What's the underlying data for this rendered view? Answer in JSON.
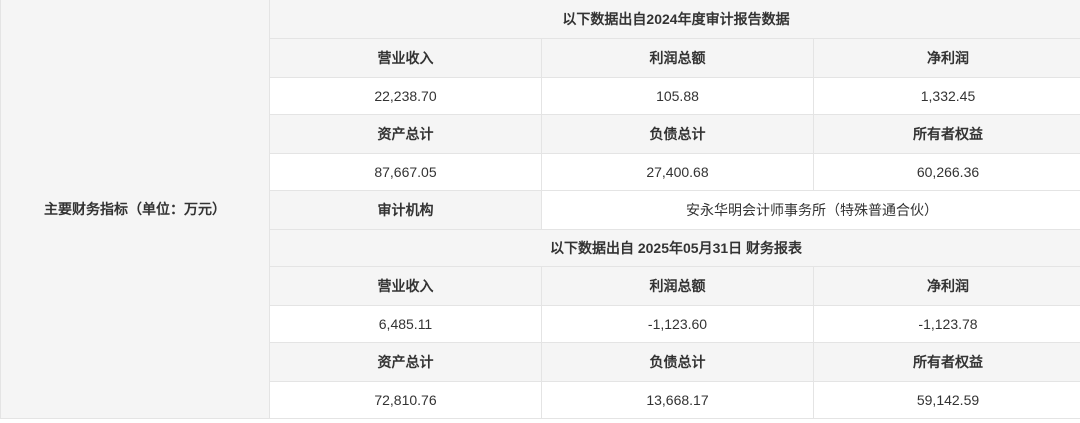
{
  "main_label": "主要财务指标（单位：万元）",
  "section1": {
    "title": "以下数据出自2024年度审计报告数据",
    "headers1": [
      "营业收入",
      "利润总额",
      "净利润"
    ],
    "values1": [
      "22,238.70",
      "105.88",
      "1,332.45"
    ],
    "headers2": [
      "资产总计",
      "负债总计",
      "所有者权益"
    ],
    "values2": [
      "87,667.05",
      "27,400.68",
      "60,266.36"
    ],
    "audit_label": "审计机构",
    "audit_value": "安永华明会计师事务所（特殊普通合伙）"
  },
  "section2": {
    "title": "以下数据出自 2025年05月31日 财务报表",
    "headers1": [
      "营业收入",
      "利润总额",
      "净利润"
    ],
    "values1": [
      "6,485.11",
      "-1,123.60",
      "-1,123.78"
    ],
    "headers2": [
      "资产总计",
      "负债总计",
      "所有者权益"
    ],
    "values2": [
      "72,810.76",
      "13,668.17",
      "59,142.59"
    ]
  }
}
